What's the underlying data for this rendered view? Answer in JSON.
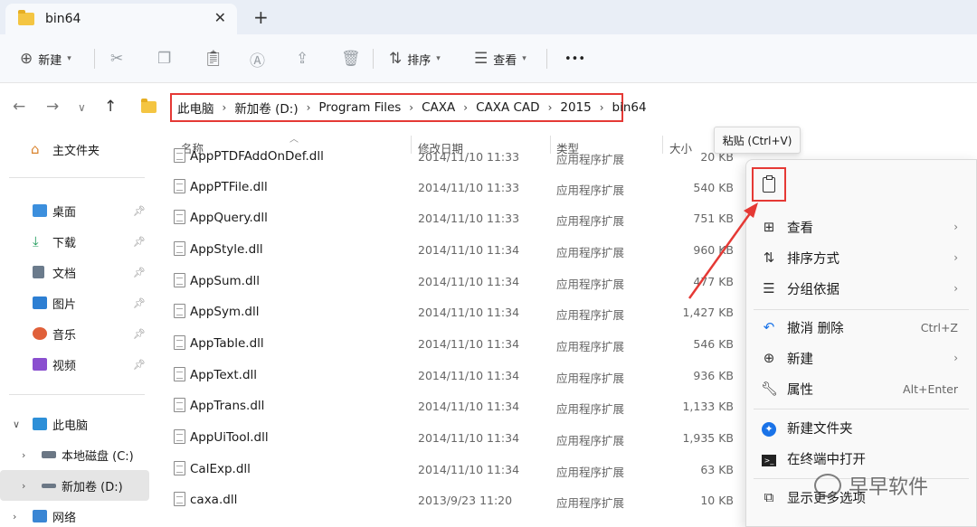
{
  "tab": {
    "title": "bin64",
    "close_glyph": "✕",
    "new_tab_glyph": "+"
  },
  "toolbar": {
    "new_label": "新建",
    "sort_label": "排序",
    "view_label": "查看",
    "more_glyph": "•••"
  },
  "address": {
    "crumbs": [
      "此电脑",
      "新加卷 (D:)",
      "Program Files",
      "CAXA",
      "CAXA CAD",
      "2015",
      "bin64"
    ],
    "separator": "›"
  },
  "sidebar": {
    "home": "主文件夹",
    "quick": [
      {
        "label": "桌面",
        "color": "#3c8fdd"
      },
      {
        "label": "下载",
        "color": "#1d9a5a"
      },
      {
        "label": "文档",
        "color": "#6b7b8c"
      },
      {
        "label": "图片",
        "color": "#2d7fd3"
      },
      {
        "label": "音乐",
        "color": "#e0603a"
      },
      {
        "label": "视频",
        "color": "#8a4fcf"
      }
    ],
    "this_pc": "此电脑",
    "drive_c": "本地磁盘 (C:)",
    "drive_d": "新加卷 (D:)",
    "network": "网络"
  },
  "columns": {
    "name": "名称",
    "date": "修改日期",
    "type": "类型",
    "size": "大小"
  },
  "files": [
    {
      "name": "AppPTDFAddOnDef.dll",
      "date": "2014/11/10 11:33",
      "type": "应用程序扩展",
      "size": "20 KB"
    },
    {
      "name": "AppPTFile.dll",
      "date": "2014/11/10 11:33",
      "type": "应用程序扩展",
      "size": "540 KB"
    },
    {
      "name": "AppQuery.dll",
      "date": "2014/11/10 11:33",
      "type": "应用程序扩展",
      "size": "751 KB"
    },
    {
      "name": "AppStyle.dll",
      "date": "2014/11/10 11:34",
      "type": "应用程序扩展",
      "size": "960 KB"
    },
    {
      "name": "AppSum.dll",
      "date": "2014/11/10 11:34",
      "type": "应用程序扩展",
      "size": "477 KB"
    },
    {
      "name": "AppSym.dll",
      "date": "2014/11/10 11:34",
      "type": "应用程序扩展",
      "size": "1,427 KB"
    },
    {
      "name": "AppTable.dll",
      "date": "2014/11/10 11:34",
      "type": "应用程序扩展",
      "size": "546 KB"
    },
    {
      "name": "AppText.dll",
      "date": "2014/11/10 11:34",
      "type": "应用程序扩展",
      "size": "936 KB"
    },
    {
      "name": "AppTrans.dll",
      "date": "2014/11/10 11:34",
      "type": "应用程序扩展",
      "size": "1,133 KB"
    },
    {
      "name": "AppUiTool.dll",
      "date": "2014/11/10 11:34",
      "type": "应用程序扩展",
      "size": "1,935 KB"
    },
    {
      "name": "CalExp.dll",
      "date": "2014/11/10 11:34",
      "type": "应用程序扩展",
      "size": "63 KB"
    },
    {
      "name": "caxa.dll",
      "date": "2013/9/23 11:20",
      "type": "应用程序扩展",
      "size": "10 KB"
    }
  ],
  "tooltip": "粘贴 (Ctrl+V)",
  "context_menu": {
    "view": "查看",
    "sort_by": "排序方式",
    "group_by": "分组依据",
    "undo_delete": "撤消 删除",
    "undo_shortcut": "Ctrl+Z",
    "new": "新建",
    "properties": "属性",
    "properties_shortcut": "Alt+Enter",
    "new_folder": "新建文件夹",
    "open_terminal": "在终端中打开",
    "more_options": "显示更多选项"
  },
  "watermark": "早早软件",
  "colors": {
    "highlight_red": "#e53935",
    "folder_yellow": "#f4c542"
  }
}
